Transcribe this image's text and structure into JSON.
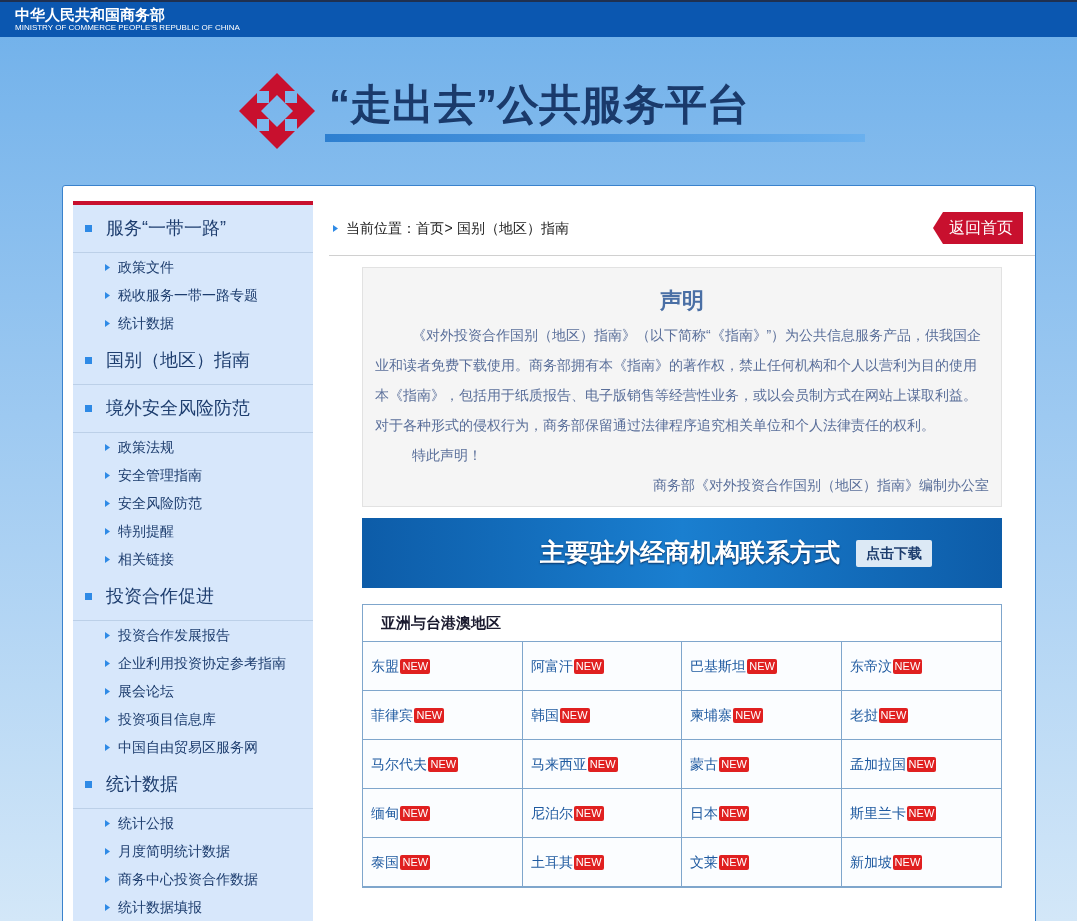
{
  "top_bar": {
    "title": "中华人民共和国商务部",
    "subtitle": "MINISTRY OF COMMERCE PEOPLE'S REPUBLIC OF CHINA"
  },
  "header": {
    "title": "“走出去”公共服务平台"
  },
  "sidebar": {
    "sections": [
      {
        "title": "服务“一带一路”",
        "items": [
          "政策文件",
          "税收服务一带一路专题",
          "统计数据"
        ]
      },
      {
        "title": "国别（地区）指南"
      },
      {
        "title": "境外安全风险防范",
        "items": [
          "政策法规",
          "安全管理指南",
          "安全风险防范",
          "特别提醒",
          "相关链接"
        ]
      },
      {
        "title": "投资合作促进",
        "items": [
          "投资合作发展报告",
          "企业利用投资协定参考指南",
          "展会论坛",
          "投资项目信息库",
          "中国自由贸易区服务网"
        ]
      },
      {
        "title": "统计数据",
        "items": [
          "统计公报",
          "月度简明统计数据",
          "商务中心投资合作数据",
          "统计数据填报"
        ]
      }
    ]
  },
  "breadcrumb": "当前位置：首页> 国别（地区）指南",
  "back_button": "返回首页",
  "notice": {
    "title": "声明",
    "paragraph": "《对外投资合作国别（地区）指南》（以下简称“《指南》”）为公共信息服务产品，供我国企业和读者免费下载使用。商务部拥有本《指南》的著作权，禁止任何机构和个人以营利为目的使用本《指南》，包括用于纸质报告、电子版销售等经营性业务，或以会员制方式在网站上谋取利益。对于各种形式的侵权行为，商务部保留通过法律程序追究相关单位和个人法律责任的权利。",
    "closing": "特此声明！",
    "signature": "商务部《对外投资合作国别（地区）指南》编制办公室"
  },
  "download_banner": {
    "title": "主要驻外经商机构联系方式",
    "button": "点击下载"
  },
  "region_table": {
    "title": "亚洲与台港澳地区",
    "countries": [
      {
        "name": "东盟",
        "badge": "NEW"
      },
      {
        "name": "阿富汗",
        "badge": "NEW"
      },
      {
        "name": "巴基斯坦",
        "badge": "NEW"
      },
      {
        "name": "东帝汶",
        "badge": "NEW"
      },
      {
        "name": "菲律宾",
        "badge": "NEW"
      },
      {
        "name": "韩国",
        "badge": "NEW"
      },
      {
        "name": "柬埔寨",
        "badge": "NEW"
      },
      {
        "name": "老挝",
        "badge": "NEW"
      },
      {
        "name": "马尔代夫",
        "badge": "NEW"
      },
      {
        "name": "马来西亚",
        "badge": "NEW"
      },
      {
        "name": "蒙古",
        "badge": "NEW"
      },
      {
        "name": "孟加拉国",
        "badge": "NEW"
      },
      {
        "name": "缅甸",
        "badge": "NEW"
      },
      {
        "name": "尼泊尔",
        "badge": "NEW"
      },
      {
        "name": "日本",
        "badge": "NEW"
      },
      {
        "name": "斯里兰卡",
        "badge": "NEW"
      },
      {
        "name": "泰国",
        "badge": "NEW"
      },
      {
        "name": "土耳其",
        "badge": "NEW"
      },
      {
        "name": "文莱",
        "badge": "NEW"
      },
      {
        "name": "新加坡",
        "badge": "NEW"
      }
    ]
  }
}
